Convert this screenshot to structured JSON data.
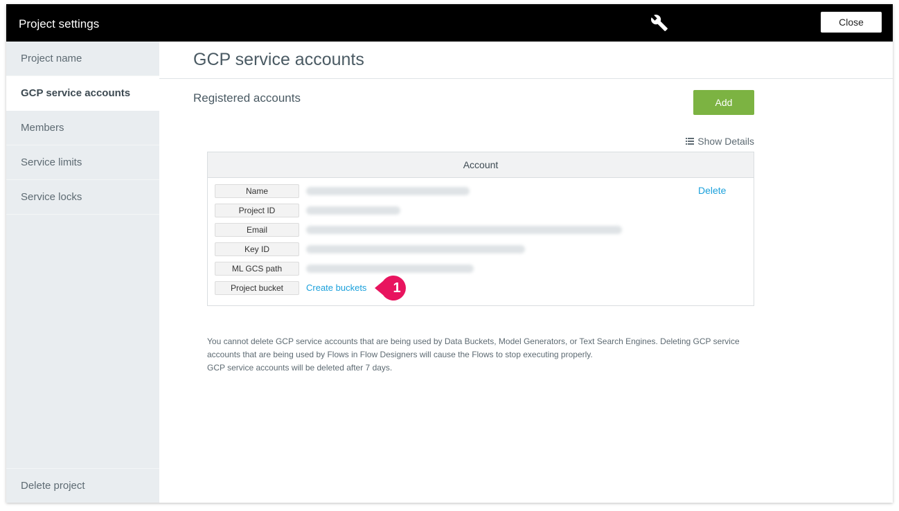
{
  "window": {
    "title": "Project settings",
    "close_label": "Close"
  },
  "sidebar": {
    "items": [
      {
        "label": "Project name"
      },
      {
        "label": "GCP service accounts"
      },
      {
        "label": "Members"
      },
      {
        "label": "Service limits"
      },
      {
        "label": "Service locks"
      }
    ],
    "active": "GCP service accounts",
    "bottom_item": "Delete project"
  },
  "main": {
    "title": "GCP service accounts",
    "section_title": "Registered accounts",
    "add_label": "Add",
    "show_details_label": "Show Details",
    "table": {
      "header": "Account",
      "fields": [
        "Name",
        "Project ID",
        "Email",
        "Key ID",
        "ML GCS path",
        "Project bucket"
      ],
      "delete_label": "Delete",
      "create_buckets_label": "Create buckets"
    },
    "callout_number": "1",
    "notice_lines": [
      "You cannot delete GCP service accounts that are being used by Data Buckets, Model Generators, or Text Search Engines. Deleting GCP service",
      "accounts that are being used by Flows in Flow Designers will cause the Flows to stop executing properly.",
      "GCP service accounts will be deleted after 7 days."
    ]
  },
  "colors": {
    "topbar": "#000000",
    "sidebar": "#e9edf0",
    "accent_green": "#7cb342",
    "link_blue": "#1aa0db",
    "callout_pink": "#e8145e"
  },
  "icons": [
    "wrench-icon",
    "list-icon"
  ]
}
